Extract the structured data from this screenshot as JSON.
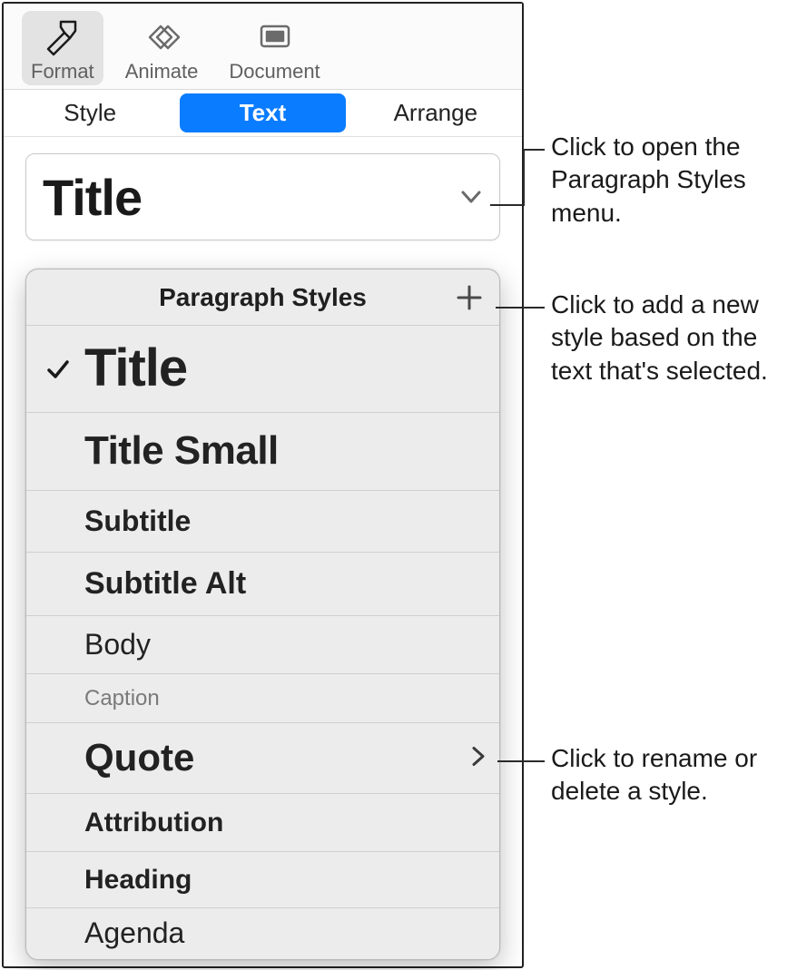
{
  "toolbar": {
    "format": "Format",
    "animate": "Animate",
    "document": "Document"
  },
  "tabs": {
    "style": "Style",
    "text": "Text",
    "arrange": "Arrange"
  },
  "current_style": "Title",
  "popover": {
    "title": "Paragraph Styles",
    "styles": [
      {
        "name": "Title",
        "selected": true,
        "has_submenu": false
      },
      {
        "name": "Title Small",
        "selected": false,
        "has_submenu": false
      },
      {
        "name": "Subtitle",
        "selected": false,
        "has_submenu": false
      },
      {
        "name": "Subtitle Alt",
        "selected": false,
        "has_submenu": false
      },
      {
        "name": "Body",
        "selected": false,
        "has_submenu": false
      },
      {
        "name": "Caption",
        "selected": false,
        "has_submenu": false
      },
      {
        "name": "Quote",
        "selected": false,
        "has_submenu": true
      },
      {
        "name": "Attribution",
        "selected": false,
        "has_submenu": false
      },
      {
        "name": "Heading",
        "selected": false,
        "has_submenu": false
      },
      {
        "name": "Agenda",
        "selected": false,
        "has_submenu": false
      }
    ]
  },
  "callouts": {
    "open_menu": "Click to open the Paragraph Styles menu.",
    "add_style": "Click to add a new style based on the text that's selected.",
    "rename_delete": "Click to rename or delete a style."
  }
}
